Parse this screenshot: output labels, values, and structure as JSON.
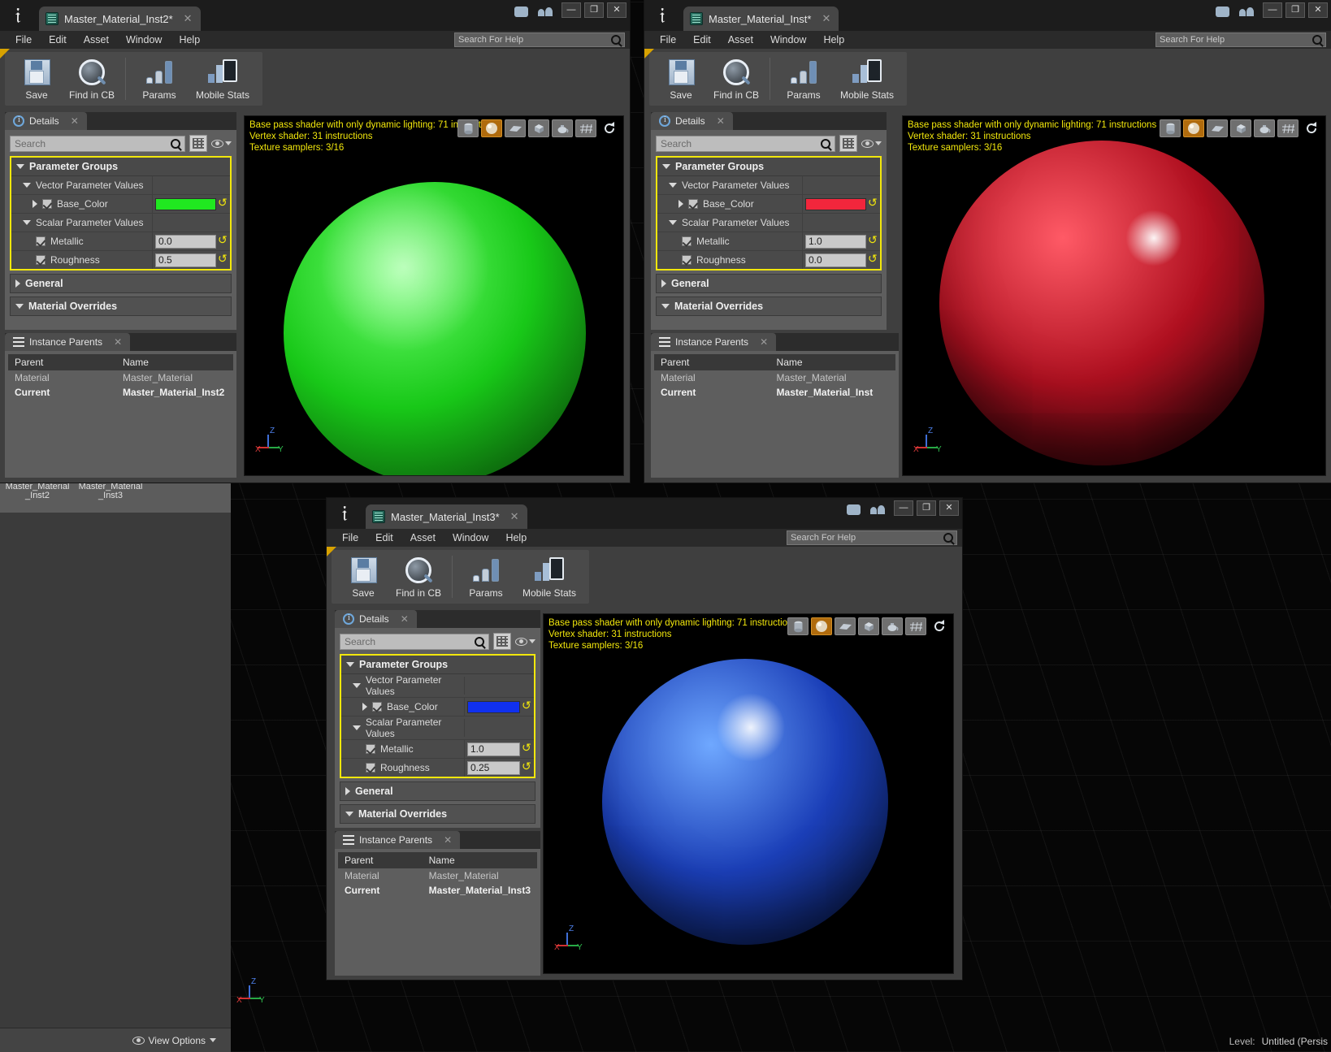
{
  "app": {
    "menus": [
      "File",
      "Edit",
      "Asset",
      "Window",
      "Help"
    ],
    "help_search_placeholder": "Search For Help",
    "toolbar": [
      {
        "label": "Save",
        "icon": "floppy-disk-icon"
      },
      {
        "label": "Find in CB",
        "icon": "magnifier-icon"
      },
      {
        "label": "Params",
        "icon": "bar-chart-icon"
      },
      {
        "label": "Mobile Stats",
        "icon": "mobile-stats-icon"
      }
    ],
    "details_tab": "Details",
    "instance_parents_tab": "Instance Parents",
    "search_placeholder": "Search",
    "groups": {
      "parameter_groups": "Parameter Groups",
      "vector_parameter_values": "Vector Parameter Values",
      "scalar_parameter_values": "Scalar Parameter Values",
      "general": "General",
      "material_overrides": "Material Overrides"
    },
    "params": {
      "base_color": "Base_Color",
      "metallic": "Metallic",
      "roughness": "Roughness"
    },
    "parents_columns": [
      "Parent",
      "Name"
    ],
    "parent_row_labels": {
      "material": "Material",
      "current": "Current"
    },
    "viewport_tools": [
      "cylinder-preview-icon",
      "sphere-preview-icon",
      "plane-preview-icon",
      "cube-preview-icon",
      "teapot-preview-icon",
      "grid-preview-icon",
      "reset-preview-icon"
    ],
    "axis_labels": {
      "x": "X",
      "y": "Y",
      "z": "Z"
    }
  },
  "windows": [
    {
      "id": "win-green",
      "title": "Master_Material_Inst2*",
      "stats": {
        "line1": "Base pass shader with only dynamic lighting: 71 instructions",
        "line2": "Vertex shader: 31 instructions",
        "line3": "Texture samplers: 3/16"
      },
      "values": {
        "base_color_hex": "#20e820",
        "metallic": "0.0",
        "roughness": "0.5"
      },
      "parents": {
        "material": "Master_Material",
        "current": "Master_Material_Inst2"
      },
      "sphere_color": "#18c818"
    },
    {
      "id": "win-red",
      "title": "Master_Material_Inst*",
      "stats": {
        "line1": "Base pass shader with only dynamic lighting: 71 instructions",
        "line2": "Vertex shader: 31 instructions",
        "line3": "Texture samplers: 3/16"
      },
      "values": {
        "base_color_hex": "#f2263c",
        "metallic": "1.0",
        "roughness": "0.0"
      },
      "parents": {
        "material": "Master_Material",
        "current": "Master_Material_Inst"
      },
      "sphere_color": "#b01020"
    },
    {
      "id": "win-blue",
      "title": "Master_Material_Inst3*",
      "stats": {
        "line1": "Base pass shader with only dynamic lighting: 71 instructions",
        "line2": "Vertex shader: 31 instructions",
        "line3": "Texture samplers: 3/16"
      },
      "values": {
        "base_color_hex": "#1030ee",
        "metallic": "1.0",
        "roughness": "0.25"
      },
      "parents": {
        "material": "Master_Material",
        "current": "Master_Material_Inst3"
      },
      "sphere_color": "#1b3fb8"
    }
  ],
  "content_browser": {
    "assets": [
      "Master_Material _Inst2",
      "Master_Material _Inst3"
    ],
    "view_options": "View Options"
  },
  "status_bar": {
    "level_label": "Level:",
    "level_value": "Untitled (Persis"
  },
  "window_buttons": {
    "minimize": "—",
    "maximize": "❐",
    "close": "✕"
  }
}
